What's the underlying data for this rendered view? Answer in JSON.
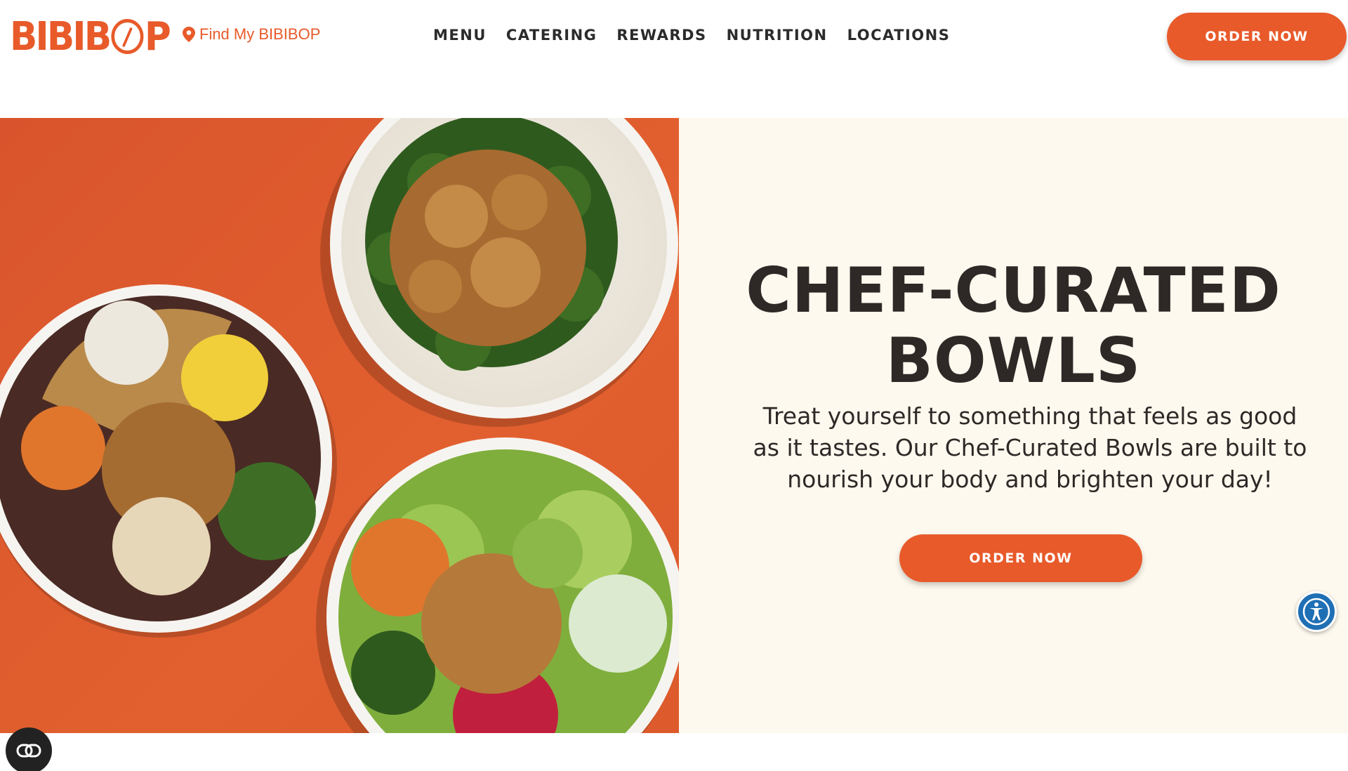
{
  "header": {
    "logo_text": "BIBIBOP",
    "find_location": "Find My BIBIBOP",
    "nav": [
      "MENU",
      "CATERING",
      "REWARDS",
      "NUTRITION",
      "LOCATIONS"
    ],
    "order_button": "ORDER NOW"
  },
  "hero": {
    "title_line1": "CHEF-CURATED",
    "title_line2": "BOWLS",
    "description": "Treat yourself to something that feels as good as it tastes. Our Chef-Curated Bowls are built to nourish your body and brighten your day!",
    "order_button": "ORDER NOW"
  },
  "colors": {
    "brand": "#e85a2a",
    "panel_background": "#fdf9ee",
    "text_dark": "#2e2927",
    "accessibility_blue": "#1f6fb5"
  },
  "icons": {
    "location": "map-pin-icon",
    "accessibility": "accessibility-icon",
    "chat": "chat-icon"
  }
}
